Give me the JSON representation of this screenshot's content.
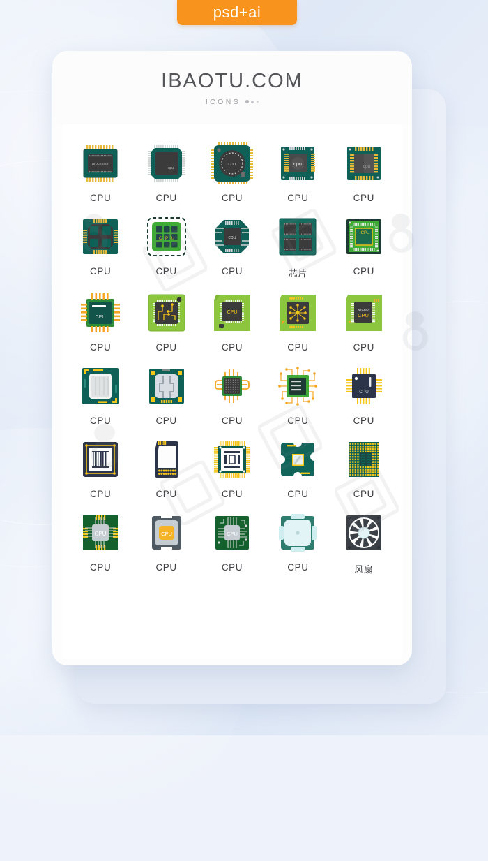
{
  "badge": {
    "label": "psd+ai",
    "color": "#f8941d"
  },
  "header": {
    "brand": "IBAOTU.COM",
    "subtitle": "ICONS",
    "dots": "•••"
  },
  "palette": {
    "bg_top": "#e8eef9",
    "card": "#fdfdfe",
    "teal": "#10625a",
    "dark_teal": "#0d5b52",
    "green": "#8cc63f",
    "bright_green": "#3faa35",
    "navy": "#2b3448",
    "gold": "#f5c518",
    "gray_chip": "#3a3a3a",
    "label_color": "#3e3f43"
  },
  "icons": [
    {
      "id": 1,
      "label": "CPU",
      "chip_text": "processor",
      "style": "teal-dip"
    },
    {
      "id": 2,
      "label": "CPU",
      "chip_text": "cpu",
      "style": "teal-qfp"
    },
    {
      "id": 3,
      "label": "CPU",
      "chip_text": "cpu",
      "style": "teal-round"
    },
    {
      "id": 4,
      "label": "CPU",
      "chip_text": "cpu",
      "style": "teal-square-pins"
    },
    {
      "id": 5,
      "label": "CPU",
      "chip_text": "cpu",
      "style": "teal-gold-pins"
    },
    {
      "id": 6,
      "label": "CPU",
      "chip_text": "",
      "style": "quad-core"
    },
    {
      "id": 7,
      "label": "CPU",
      "chip_text": "C P U",
      "style": "green-dashed-grid"
    },
    {
      "id": 8,
      "label": "CPU",
      "chip_text": "cpu",
      "style": "octagon-teal"
    },
    {
      "id": 9,
      "label": "芯片",
      "chip_text": "",
      "style": "four-dies"
    },
    {
      "id": 10,
      "label": "CPU",
      "chip_text": "CPU",
      "style": "green-socket"
    },
    {
      "id": 11,
      "label": "CPU",
      "chip_text": "CPU",
      "style": "gold-leg-chip"
    },
    {
      "id": 12,
      "label": "CPU",
      "chip_text": "",
      "style": "lime-traces"
    },
    {
      "id": 13,
      "label": "CPU",
      "chip_text": "CPU",
      "style": "lime-notch"
    },
    {
      "id": 14,
      "label": "CPU",
      "chip_text": "",
      "style": "lime-nodes"
    },
    {
      "id": 15,
      "label": "CPU",
      "chip_text": "MICRO CPU",
      "style": "lime-micro"
    },
    {
      "id": 16,
      "label": "CPU",
      "chip_text": "",
      "style": "heatspreader-a"
    },
    {
      "id": 17,
      "label": "CPU",
      "chip_text": "",
      "style": "heatspreader-b"
    },
    {
      "id": 18,
      "label": "CPU",
      "chip_text": "",
      "style": "curved-leads"
    },
    {
      "id": 19,
      "label": "CPU",
      "chip_text": "",
      "style": "circuit-green"
    },
    {
      "id": 20,
      "label": "CPU",
      "chip_text": "CPU",
      "style": "navy-pins"
    },
    {
      "id": 21,
      "label": "CPU",
      "chip_text": "",
      "style": "navy-barcode"
    },
    {
      "id": 22,
      "label": "CPU",
      "chip_text": "",
      "style": "sd-card"
    },
    {
      "id": 23,
      "label": "CPU",
      "chip_text": "",
      "style": "navy-yellow-pins"
    },
    {
      "id": 24,
      "label": "CPU",
      "chip_text": "",
      "style": "teal-socket-die"
    },
    {
      "id": 25,
      "label": "CPU",
      "chip_text": "",
      "style": "pga-grid"
    },
    {
      "id": 26,
      "label": "CPU",
      "chip_text": "CPU",
      "style": "darkgreen-silver"
    },
    {
      "id": 27,
      "label": "CPU",
      "chip_text": "CPU",
      "style": "gold-die"
    },
    {
      "id": 28,
      "label": "CPU",
      "chip_text": "CPU",
      "style": "darkgreen-traces"
    },
    {
      "id": 29,
      "label": "CPU",
      "chip_text": "",
      "style": "mint-lid"
    },
    {
      "id": 30,
      "label": "风扇",
      "chip_text": "",
      "style": "fan"
    }
  ]
}
